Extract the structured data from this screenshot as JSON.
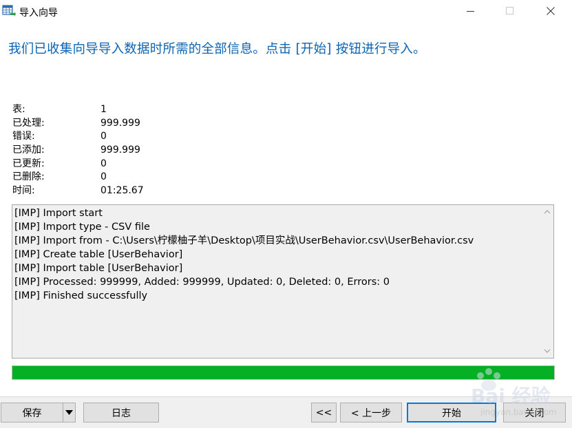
{
  "window": {
    "title": "导入向导",
    "icon": "table-import-icon"
  },
  "headline": "我们已收集向导导入数据时所需的全部信息。点击 [开始] 按钮进行导入。",
  "stats": [
    {
      "label": "表:",
      "value": "1"
    },
    {
      "label": "已处理:",
      "value": "999.999"
    },
    {
      "label": "错误:",
      "value": "0"
    },
    {
      "label": "已添加:",
      "value": "999.999"
    },
    {
      "label": "已更新:",
      "value": "0"
    },
    {
      "label": "已删除:",
      "value": "0"
    },
    {
      "label": "时间:",
      "value": "01:25.67"
    }
  ],
  "log": [
    "[IMP] Import start",
    "[IMP] Import type - CSV file",
    "[IMP] Import from - C:\\Users\\柠檬柚子羊\\Desktop\\项目实战\\UserBehavior.csv\\UserBehavior.csv",
    "[IMP] Create table [UserBehavior]",
    "[IMP] Import table [UserBehavior]",
    "[IMP] Processed: 999999, Added: 999999, Updated: 0, Deleted: 0, Errors: 0",
    "[IMP] Finished successfully"
  ],
  "progress": {
    "percent": 100,
    "color": "#06b025"
  },
  "buttons": {
    "save": "保存",
    "log": "日志",
    "first": "<<",
    "back": "< 上一步",
    "start": "开始",
    "close": "关闭"
  },
  "colors": {
    "headline": "#0c64b4",
    "accent": "#0078d7"
  },
  "watermark": {
    "text": "Bai 经验",
    "url": "jingyan.baidu.com"
  }
}
